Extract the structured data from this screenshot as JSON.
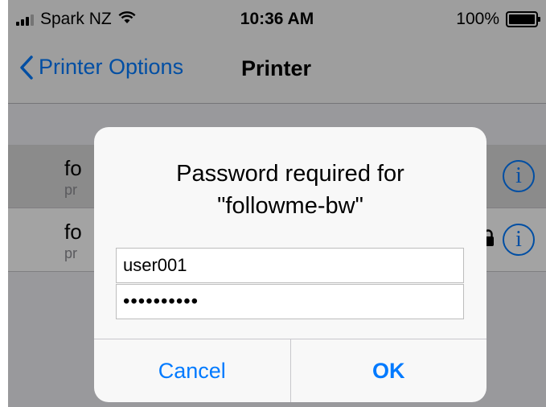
{
  "status_bar": {
    "carrier": "Spark NZ",
    "time": "10:36 AM",
    "battery_percent": "100%",
    "battery_level": 1.0
  },
  "nav": {
    "back_label": "Printer Options",
    "title": "Printer"
  },
  "printers": [
    {
      "name": "fo",
      "subtitle": "pr",
      "selected": true
    },
    {
      "name": "fo",
      "subtitle": "pr",
      "selected": false
    }
  ],
  "dialog": {
    "title_line1": "Password required for",
    "title_line2": "\"followme-bw\"",
    "username_value": "user001",
    "password_value": "••••••••••",
    "cancel_label": "Cancel",
    "ok_label": "OK"
  },
  "icons": {
    "info": "info-icon",
    "back": "chevron-left-icon",
    "lock": "lock-icon",
    "wifi": "wifi-icon"
  },
  "colors": {
    "accent": "#007aff",
    "dialog_bg": "#f8f8f8",
    "screen_bg": "#efeff4"
  }
}
